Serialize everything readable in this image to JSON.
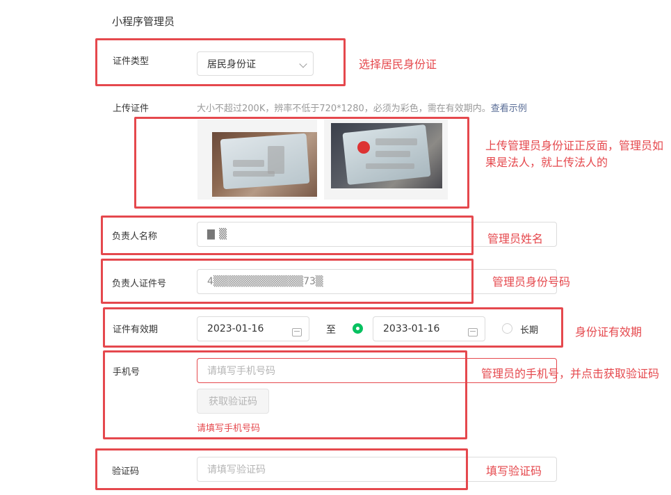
{
  "section": {
    "title": "小程序管理员"
  },
  "id_type": {
    "label": "证件类型",
    "value": "居民身份证"
  },
  "upload": {
    "label": "上传证件",
    "hint": "大小不超过200K，辨率不低于720*1280，必须为彩色，需在有效期内。",
    "example_link": "查看示例"
  },
  "name": {
    "label": "负责人名称",
    "value": "▇ ▒"
  },
  "id_number": {
    "label": "负责人证件号",
    "value": "4▒▒▒▒▒▒▒▒▒▒▒▒73▒"
  },
  "validity": {
    "label": "证件有效期",
    "start": "2023-01-16",
    "to": "至",
    "end": "2033-01-16",
    "long_term": "长期"
  },
  "phone": {
    "label": "手机号",
    "placeholder": "请填写手机号码",
    "get_code": "获取验证码",
    "error": "请填写手机号码"
  },
  "code": {
    "label": "验证码",
    "placeholder": "请填写验证码"
  },
  "annotations": {
    "id_type": "选择居民身份证",
    "upload": "上传管理员身份证正反面，管理员如果是法人，就上传法人的",
    "name": "管理员姓名",
    "id_number": "管理员身份号码",
    "validity": "身份证有效期",
    "phone": "管理员的手机号，并点击获取验证码",
    "code": "填写验证码"
  },
  "colors": {
    "annotation_red": "#e5484d",
    "accent_green": "#07c160",
    "link": "#576b95"
  }
}
